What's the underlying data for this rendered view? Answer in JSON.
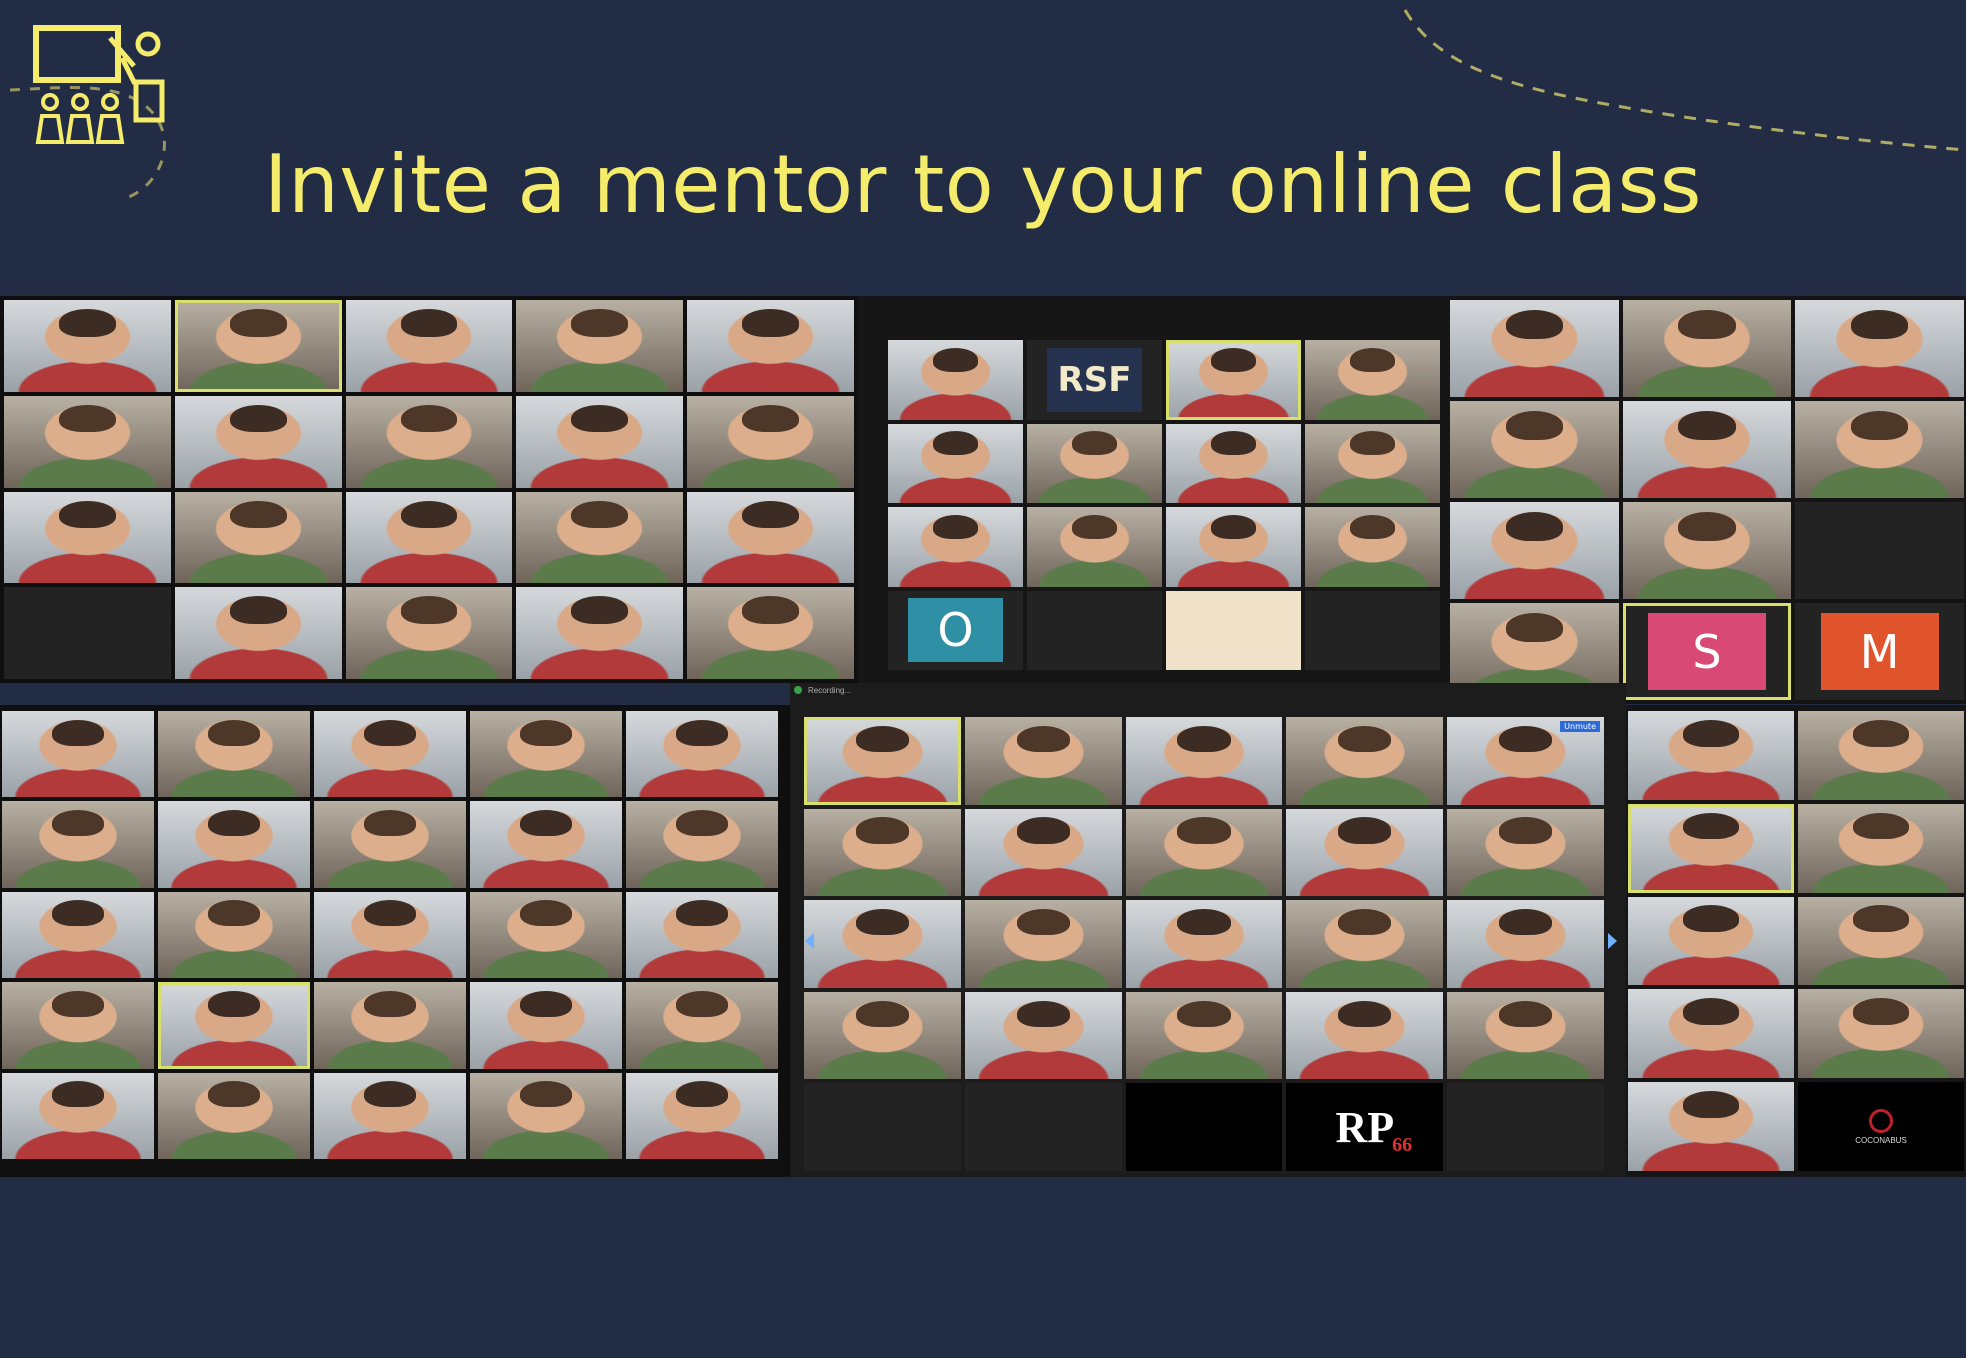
{
  "slide": {
    "title": "Invite a mentor to your online class",
    "accent_color": "#f4ec6a",
    "background_color": "#222c44",
    "logo_icon": "teacher-classroom-icon"
  },
  "screens": {
    "meeting_1": {
      "avatars": [],
      "panel_color": "#0f0f0f"
    },
    "meeting_2": {
      "avatars": [
        "RSF",
        "O"
      ],
      "panel_color": "#0f0f0f"
    },
    "meeting_3": {
      "avatars": [
        "S",
        "M"
      ],
      "panel_color": "#0f0f0f"
    },
    "meeting_4": {
      "recording_label": "Recording...",
      "pinned_tag": "Unmute",
      "logos": [
        "RP",
        "66"
      ],
      "panel_color": "#0f0f0f"
    },
    "meeting_5": {
      "logo_text": "COCONABUS",
      "panel_color": "#0f0f0f"
    }
  },
  "avatar_colors": {
    "RSF": "#263350",
    "O": "#2e8fa5",
    "S": "#d84a75",
    "M": "#e0542c"
  }
}
